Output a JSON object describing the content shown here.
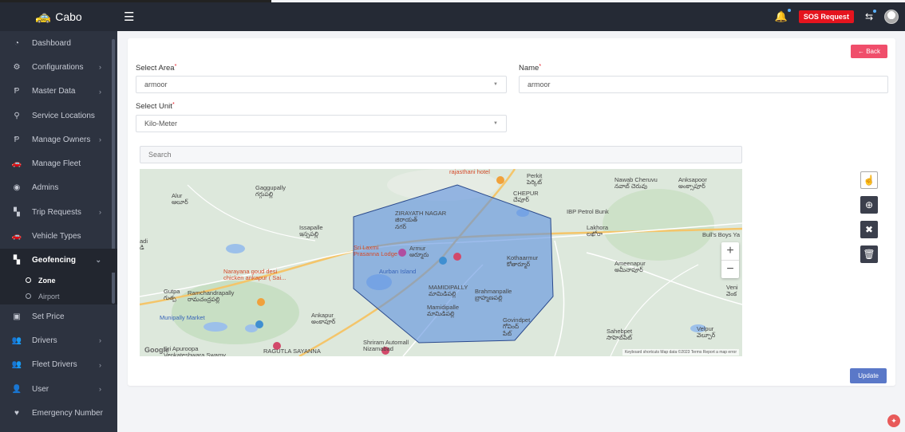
{
  "brand": {
    "name": "Cabo",
    "logo_icon": "car-logo-icon"
  },
  "topbar": {
    "sos_label": "SOS Request"
  },
  "sidebar": {
    "items": [
      {
        "label": "Dashboard",
        "icon": "dashboard-icon",
        "chevron": false
      },
      {
        "label": "Configurations",
        "icon": "cogs-icon",
        "chevron": true
      },
      {
        "label": "Master Data",
        "icon": "p-icon",
        "chevron": true
      },
      {
        "label": "Service Locations",
        "icon": "location-pin-icon",
        "chevron": false
      },
      {
        "label": "Manage Owners",
        "icon": "p-icon",
        "chevron": true
      },
      {
        "label": "Manage Fleet",
        "icon": "car-icon",
        "chevron": false
      },
      {
        "label": "Admins",
        "icon": "user-circle-icon",
        "chevron": false
      },
      {
        "label": "Trip Requests",
        "icon": "map-icon",
        "chevron": true
      },
      {
        "label": "Vehicle Types",
        "icon": "car-icon",
        "chevron": false
      },
      {
        "label": "Geofencing",
        "icon": "map-icon",
        "chevron": "down",
        "active": true
      }
    ],
    "sub_items": [
      {
        "label": "Zone",
        "active": true
      },
      {
        "label": "Airport",
        "active": false
      }
    ],
    "items_after": [
      {
        "label": "Set Price",
        "icon": "money-icon",
        "chevron": false
      },
      {
        "label": "Drivers",
        "icon": "users-icon",
        "chevron": true
      },
      {
        "label": "Fleet Drivers",
        "icon": "users-icon",
        "chevron": true
      },
      {
        "label": "User",
        "icon": "user-icon",
        "chevron": true
      },
      {
        "label": "Emergency Number",
        "icon": "heart-icon",
        "chevron": false
      }
    ]
  },
  "form": {
    "back_label": "← Back",
    "select_area_label": "Select Area",
    "select_area_value": "armoor",
    "name_label": "Name",
    "name_value": "armoor",
    "select_unit_label": "Select Unit",
    "select_unit_value": "Kilo-Meter",
    "search_placeholder": "Search",
    "update_label": "Update"
  },
  "map": {
    "attribution": "Keyboard shortcuts   Map data ©2023   Terms   Report a map error",
    "google": "Google",
    "labels": [
      "Alur\nఆలూర్",
      "Gaggupally\nగగ్గుపల్లి",
      "Issapalle\nఇస్సపల్లి",
      "ZIRAYATH NAGAR\nజిరాయత్\nనగర్",
      "Sri Laxmi\nPrasanna Lodge",
      "Armur\nఆర్మూరు",
      "Aurban Island",
      "Kothaarmur\nకోతార్మూర్",
      "Brahmanpalle\nబ్రాహ్మణపల్లి",
      "Mamidipalle\nమామిడిపల్లి",
      "Govindpet\nగోవింద్\nపేట్",
      "Ankapur\nఅంకాపూర్",
      "Gutpa\nగుత్ప",
      "Ramchandrapally\nరామచంద్రపల్లి",
      "Munipally Market",
      "Narayana goud desi\nchicken ankapur ( Sai...",
      "Perkit\nపెర్కిట్",
      "Nawab Cheruvu\nనవాబ్ చెరువు",
      "Anksapoor\nఅంక్సాపూర్",
      "IBP Petrol Bunk",
      "Lakhora\nలఖోరా",
      "Bull's Boys Ya",
      "Ameenapur\nఅమీనాపూర్",
      "Sahebpet\nసాహెబ్‌పేట్",
      "Velpur\nవెల్పూర్",
      "Veni\nవెంక",
      "adi\nడి",
      "rajasthani hotel",
      "Shriram Automall\nNizamabad",
      "RAGUTLA SAYANNA",
      "Sri Apuroopa\nVenkateshwara Swamy...",
      "CHEPUR\nచేపూర్",
      "MAMIDIPALLY\nమామిడిపల్లి"
    ]
  },
  "tools": [
    "hand-icon",
    "plus-circle-icon",
    "times-icon",
    "trash-icon"
  ]
}
